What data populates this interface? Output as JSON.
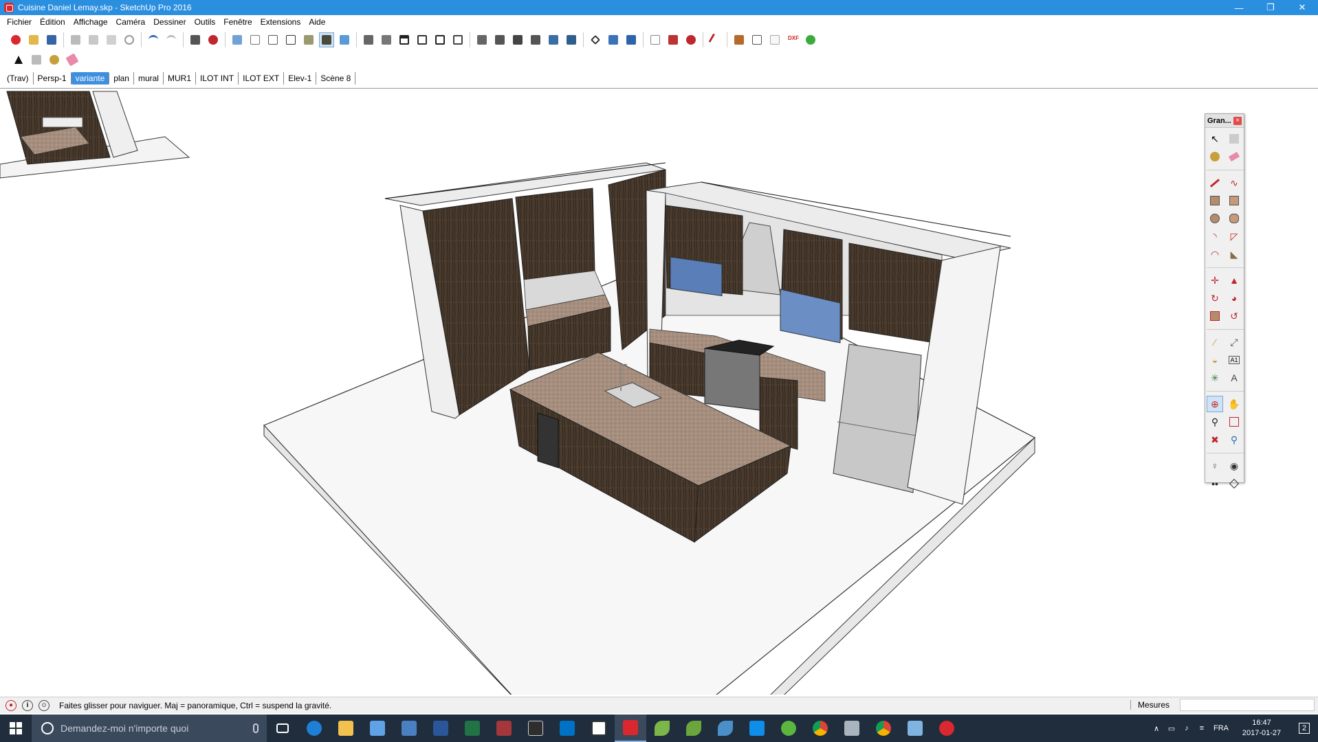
{
  "window": {
    "title": "Cuisine Daniel Lemay.skp - SketchUp Pro 2016",
    "minimize": "—",
    "maximize": "❐",
    "close": "✕"
  },
  "menu": [
    "Fichier",
    "Édition",
    "Affichage",
    "Caméra",
    "Dessiner",
    "Outils",
    "Fenêtre",
    "Extensions",
    "Aide"
  ],
  "scenes": [
    {
      "label": "(Trav)",
      "active": false
    },
    {
      "label": "Persp-1",
      "active": false
    },
    {
      "label": "variante",
      "active": true
    },
    {
      "label": "plan",
      "active": false
    },
    {
      "label": "mural",
      "active": false
    },
    {
      "label": "MUR1",
      "active": false
    },
    {
      "label": "ILOT INT",
      "active": false
    },
    {
      "label": "ILOT EXT",
      "active": false
    },
    {
      "label": "Elev-1",
      "active": false
    },
    {
      "label": "Scène 8",
      "active": false
    }
  ],
  "large_toolset": {
    "title": "Gran...",
    "close": "×"
  },
  "status": {
    "message": "Faites glisser pour naviguer. Maj = panoramique, Ctrl =  suspend la gravité.",
    "measures_label": "Mesures",
    "measures_value": "",
    "icon_info": "i",
    "icon_user": "☺"
  },
  "taskbar": {
    "search_placeholder": "Demandez-moi n'importe quoi",
    "language": "FRA",
    "time": "16:47",
    "date": "2017-01-27",
    "notifications": "2"
  },
  "colors": {
    "titlebar": "#2b8fe0",
    "scene_active": "#3d8fe0",
    "cabinet": "#4a3b2e",
    "counter": "#a58e7e",
    "floor": "#f7f7f7"
  }
}
